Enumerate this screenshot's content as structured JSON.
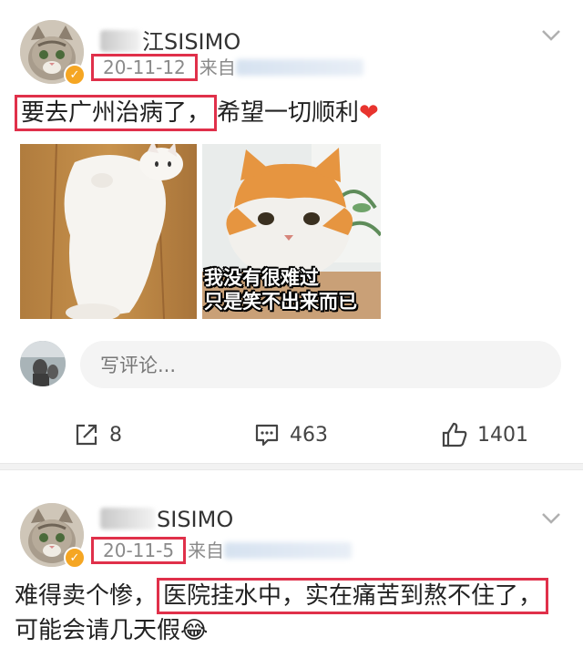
{
  "posts": [
    {
      "username_visible": "SISIMO",
      "username_prefix_visible": "江",
      "date": "20-11-12",
      "from_label": "来自",
      "content_highlight": "要去广州治病了，",
      "content_rest": "希望一切顺利",
      "content_emoji": "❤",
      "image2_caption_line1": "我没有很难过",
      "image2_caption_line2": "只是笑不出来而已",
      "comment_placeholder": "写评论...",
      "repost_count": "8",
      "comment_count": "463",
      "like_count": "1401"
    },
    {
      "username_visible": "SISIMO",
      "date": "20-11-5",
      "from_label": "来自",
      "content_start": "难得卖个惨，",
      "content_highlight": "医院挂水中，实在痛苦到熬不住了，",
      "content_line2": "可能会请几天假",
      "content_emoji": "😂"
    }
  ],
  "colors": {
    "highlight_box": "#e0304a",
    "verified_badge": "#f5a623",
    "heart": "#e8342e"
  },
  "icons": {
    "verified": "v-badge-icon",
    "chevron": "chevron-down-icon",
    "repost": "repost-icon",
    "comment": "comment-icon",
    "like": "thumbs-up-icon"
  }
}
